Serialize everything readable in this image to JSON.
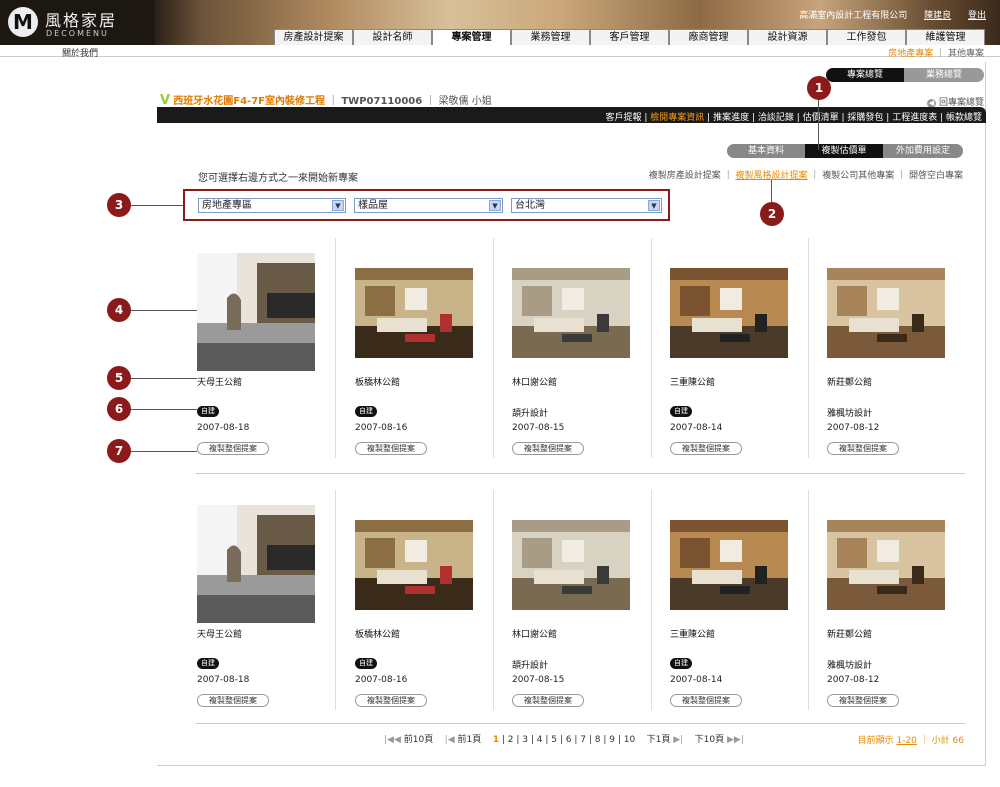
{
  "header": {
    "logo_cn": "風格家居",
    "logo_en": "DECOMENU",
    "company": "高滿室內設計工程有限公司",
    "user": "陳建良",
    "logout": "登出",
    "nav": [
      "房產設計提案",
      "設計名師",
      "專案管理",
      "業務管理",
      "客戶管理",
      "廠商管理",
      "設計資源",
      "工作發包",
      "維護管理"
    ],
    "active_nav": 2
  },
  "subbar": {
    "about": "關於我們",
    "links": [
      "房地產專案",
      "其他專案"
    ]
  },
  "switch": {
    "left": "專案總覽",
    "right": "業務總覽"
  },
  "project": {
    "mark": "V",
    "name": "西班牙水花園F4-7F室內裝修工程",
    "code": "TWP07110006",
    "client": "梁敬儒 小姐",
    "back": "回專案總覽"
  },
  "blackbar": {
    "items": [
      "客戶提報",
      "檢閱專案資訊",
      "推案進度",
      "洽談記錄",
      "估價清單",
      "採購發包",
      "工程進度表",
      "帳款總覽"
    ],
    "active": 1
  },
  "tabs": [
    "基本資料",
    "複製估價單",
    "外加費用設定"
  ],
  "active_tab": 1,
  "hint": "您可選擇右邊方式之一來開始新專案",
  "options": [
    "複製房產設計提案",
    "複製風格設計提案",
    "複製公司其他專案",
    "開啓空白專案"
  ],
  "active_option": 1,
  "selects": [
    "房地產專區",
    "樣品屋",
    "台北灣"
  ],
  "callouts": [
    "1",
    "2",
    "3",
    "4",
    "5",
    "6",
    "7"
  ],
  "cards_row1": [
    {
      "name": "天母王公館",
      "badge": "自建",
      "tag": "",
      "date": "2007-08-18",
      "button": "複製整個提案"
    },
    {
      "name": "板橋林公館",
      "badge": "自建",
      "tag": "",
      "date": "2007-08-16",
      "button": "複製整個提案"
    },
    {
      "name": "林口謝公館",
      "badge": "",
      "tag": "頡升設計",
      "date": "2007-08-15",
      "button": "複製整個提案"
    },
    {
      "name": "三重陳公館",
      "badge": "自建",
      "tag": "",
      "date": "2007-08-14",
      "button": "複製整個提案"
    },
    {
      "name": "新莊鄭公館",
      "badge": "",
      "tag": "雅楓坊設計",
      "date": "2007-08-12",
      "button": "複製整個提案"
    }
  ],
  "cards_row2": [
    {
      "name": "天母王公館",
      "badge": "自建",
      "tag": "",
      "date": "2007-08-18",
      "button": "複製整個提案"
    },
    {
      "name": "板橋林公館",
      "badge": "自建",
      "tag": "",
      "date": "2007-08-16",
      "button": "複製整個提案"
    },
    {
      "name": "林口謝公館",
      "badge": "",
      "tag": "頡升設計",
      "date": "2007-08-15",
      "button": "複製整個提案"
    },
    {
      "name": "三重陳公館",
      "badge": "自建",
      "tag": "",
      "date": "2007-08-14",
      "button": "複製整個提案"
    },
    {
      "name": "新莊鄭公館",
      "badge": "",
      "tag": "雅楓坊設計",
      "date": "2007-08-12",
      "button": "複製整個提案"
    }
  ],
  "pager": {
    "first10": "前10頁",
    "prev": "前1頁",
    "pages": [
      "1",
      "2",
      "3",
      "4",
      "5",
      "6",
      "7",
      "8",
      "9",
      "10"
    ],
    "current": "1",
    "next": "下1頁",
    "next10": "下10頁"
  },
  "count": {
    "label": "目前顯示",
    "range": "1-20",
    "total_label": "小計",
    "total": "66"
  },
  "colors": {
    "accent": "#e88a00",
    "callout": "#8b1a1a",
    "bar": "#1a1a1a"
  }
}
